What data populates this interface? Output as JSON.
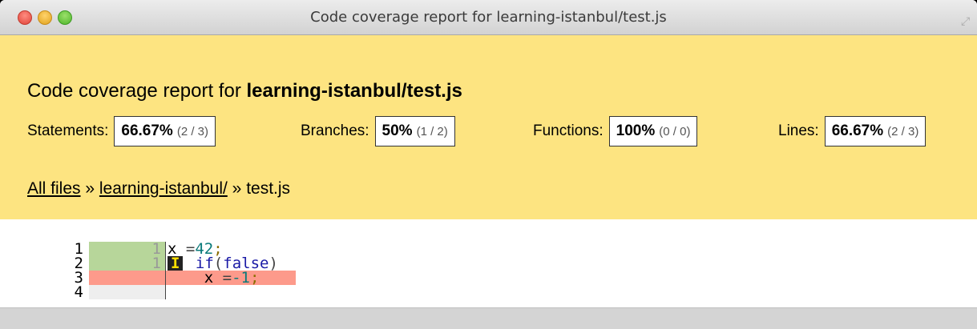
{
  "window": {
    "title": "Code coverage report for learning-istanbul/test.js"
  },
  "header": {
    "heading_prefix": "Code coverage report for ",
    "heading_file": "learning-istanbul/test.js",
    "metrics": [
      {
        "label": "Statements:",
        "pct": "66.67%",
        "frac": "(2 / 3)"
      },
      {
        "label": "Branches:",
        "pct": "50%",
        "frac": "(1 / 2)"
      },
      {
        "label": "Functions:",
        "pct": "100%",
        "frac": "(0 / 0)"
      },
      {
        "label": "Lines:",
        "pct": "66.67%",
        "frac": "(2 / 3)"
      }
    ],
    "breadcrumb": {
      "all_files": "All files",
      "sep1": " » ",
      "dir": "learning-istanbul/",
      "sep2": " » ",
      "file": "test.js"
    }
  },
  "code": {
    "lines": [
      {
        "num": "1",
        "count": "1",
        "status": "covered"
      },
      {
        "num": "2",
        "count": "1",
        "status": "covered"
      },
      {
        "num": "3",
        "count": "",
        "status": "uncovered"
      },
      {
        "num": "4",
        "count": "",
        "status": "neutral"
      }
    ],
    "line1": {
      "var": "x",
      "op": " =",
      "val": "42",
      "semi": ";"
    },
    "line2": {
      "badge": "I",
      "kw": "if",
      "open": "(",
      "cond": "false",
      "close": ")"
    },
    "line3": {
      "indent": "    ",
      "var": "x",
      "op": " =",
      "val": "-1",
      "semi": ";"
    }
  },
  "colors": {
    "header_bg": "#fde481",
    "covered": "#b7d69a",
    "uncovered": "#fd9a8b"
  }
}
